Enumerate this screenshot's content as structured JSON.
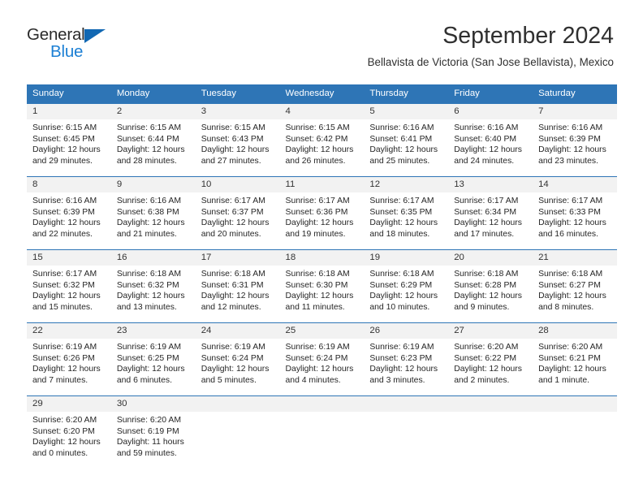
{
  "brand": {
    "name_part1": "General",
    "name_part2": "Blue",
    "accent_color": "#1b7fd4",
    "triangle_color": "#1268b3"
  },
  "header": {
    "title": "September 2024",
    "subtitle": "Bellavista de Victoria (San Jose Bellavista), Mexico"
  },
  "calendar": {
    "header_bg": "#2e75b6",
    "daynum_bg": "#f2f2f2",
    "weekday_headers": [
      "Sunday",
      "Monday",
      "Tuesday",
      "Wednesday",
      "Thursday",
      "Friday",
      "Saturday"
    ],
    "weeks": [
      [
        {
          "day": "1",
          "sunrise": "Sunrise: 6:15 AM",
          "sunset": "Sunset: 6:45 PM",
          "daylight": "Daylight: 12 hours and 29 minutes."
        },
        {
          "day": "2",
          "sunrise": "Sunrise: 6:15 AM",
          "sunset": "Sunset: 6:44 PM",
          "daylight": "Daylight: 12 hours and 28 minutes."
        },
        {
          "day": "3",
          "sunrise": "Sunrise: 6:15 AM",
          "sunset": "Sunset: 6:43 PM",
          "daylight": "Daylight: 12 hours and 27 minutes."
        },
        {
          "day": "4",
          "sunrise": "Sunrise: 6:15 AM",
          "sunset": "Sunset: 6:42 PM",
          "daylight": "Daylight: 12 hours and 26 minutes."
        },
        {
          "day": "5",
          "sunrise": "Sunrise: 6:16 AM",
          "sunset": "Sunset: 6:41 PM",
          "daylight": "Daylight: 12 hours and 25 minutes."
        },
        {
          "day": "6",
          "sunrise": "Sunrise: 6:16 AM",
          "sunset": "Sunset: 6:40 PM",
          "daylight": "Daylight: 12 hours and 24 minutes."
        },
        {
          "day": "7",
          "sunrise": "Sunrise: 6:16 AM",
          "sunset": "Sunset: 6:39 PM",
          "daylight": "Daylight: 12 hours and 23 minutes."
        }
      ],
      [
        {
          "day": "8",
          "sunrise": "Sunrise: 6:16 AM",
          "sunset": "Sunset: 6:39 PM",
          "daylight": "Daylight: 12 hours and 22 minutes."
        },
        {
          "day": "9",
          "sunrise": "Sunrise: 6:16 AM",
          "sunset": "Sunset: 6:38 PM",
          "daylight": "Daylight: 12 hours and 21 minutes."
        },
        {
          "day": "10",
          "sunrise": "Sunrise: 6:17 AM",
          "sunset": "Sunset: 6:37 PM",
          "daylight": "Daylight: 12 hours and 20 minutes."
        },
        {
          "day": "11",
          "sunrise": "Sunrise: 6:17 AM",
          "sunset": "Sunset: 6:36 PM",
          "daylight": "Daylight: 12 hours and 19 minutes."
        },
        {
          "day": "12",
          "sunrise": "Sunrise: 6:17 AM",
          "sunset": "Sunset: 6:35 PM",
          "daylight": "Daylight: 12 hours and 18 minutes."
        },
        {
          "day": "13",
          "sunrise": "Sunrise: 6:17 AM",
          "sunset": "Sunset: 6:34 PM",
          "daylight": "Daylight: 12 hours and 17 minutes."
        },
        {
          "day": "14",
          "sunrise": "Sunrise: 6:17 AM",
          "sunset": "Sunset: 6:33 PM",
          "daylight": "Daylight: 12 hours and 16 minutes."
        }
      ],
      [
        {
          "day": "15",
          "sunrise": "Sunrise: 6:17 AM",
          "sunset": "Sunset: 6:32 PM",
          "daylight": "Daylight: 12 hours and 15 minutes."
        },
        {
          "day": "16",
          "sunrise": "Sunrise: 6:18 AM",
          "sunset": "Sunset: 6:32 PM",
          "daylight": "Daylight: 12 hours and 13 minutes."
        },
        {
          "day": "17",
          "sunrise": "Sunrise: 6:18 AM",
          "sunset": "Sunset: 6:31 PM",
          "daylight": "Daylight: 12 hours and 12 minutes."
        },
        {
          "day": "18",
          "sunrise": "Sunrise: 6:18 AM",
          "sunset": "Sunset: 6:30 PM",
          "daylight": "Daylight: 12 hours and 11 minutes."
        },
        {
          "day": "19",
          "sunrise": "Sunrise: 6:18 AM",
          "sunset": "Sunset: 6:29 PM",
          "daylight": "Daylight: 12 hours and 10 minutes."
        },
        {
          "day": "20",
          "sunrise": "Sunrise: 6:18 AM",
          "sunset": "Sunset: 6:28 PM",
          "daylight": "Daylight: 12 hours and 9 minutes."
        },
        {
          "day": "21",
          "sunrise": "Sunrise: 6:18 AM",
          "sunset": "Sunset: 6:27 PM",
          "daylight": "Daylight: 12 hours and 8 minutes."
        }
      ],
      [
        {
          "day": "22",
          "sunrise": "Sunrise: 6:19 AM",
          "sunset": "Sunset: 6:26 PM",
          "daylight": "Daylight: 12 hours and 7 minutes."
        },
        {
          "day": "23",
          "sunrise": "Sunrise: 6:19 AM",
          "sunset": "Sunset: 6:25 PM",
          "daylight": "Daylight: 12 hours and 6 minutes."
        },
        {
          "day": "24",
          "sunrise": "Sunrise: 6:19 AM",
          "sunset": "Sunset: 6:24 PM",
          "daylight": "Daylight: 12 hours and 5 minutes."
        },
        {
          "day": "25",
          "sunrise": "Sunrise: 6:19 AM",
          "sunset": "Sunset: 6:24 PM",
          "daylight": "Daylight: 12 hours and 4 minutes."
        },
        {
          "day": "26",
          "sunrise": "Sunrise: 6:19 AM",
          "sunset": "Sunset: 6:23 PM",
          "daylight": "Daylight: 12 hours and 3 minutes."
        },
        {
          "day": "27",
          "sunrise": "Sunrise: 6:20 AM",
          "sunset": "Sunset: 6:22 PM",
          "daylight": "Daylight: 12 hours and 2 minutes."
        },
        {
          "day": "28",
          "sunrise": "Sunrise: 6:20 AM",
          "sunset": "Sunset: 6:21 PM",
          "daylight": "Daylight: 12 hours and 1 minute."
        }
      ],
      [
        {
          "day": "29",
          "sunrise": "Sunrise: 6:20 AM",
          "sunset": "Sunset: 6:20 PM",
          "daylight": "Daylight: 12 hours and 0 minutes."
        },
        {
          "day": "30",
          "sunrise": "Sunrise: 6:20 AM",
          "sunset": "Sunset: 6:19 PM",
          "daylight": "Daylight: 11 hours and 59 minutes."
        },
        {
          "day": "",
          "sunrise": "",
          "sunset": "",
          "daylight": ""
        },
        {
          "day": "",
          "sunrise": "",
          "sunset": "",
          "daylight": ""
        },
        {
          "day": "",
          "sunrise": "",
          "sunset": "",
          "daylight": ""
        },
        {
          "day": "",
          "sunrise": "",
          "sunset": "",
          "daylight": ""
        },
        {
          "day": "",
          "sunrise": "",
          "sunset": "",
          "daylight": ""
        }
      ]
    ]
  }
}
